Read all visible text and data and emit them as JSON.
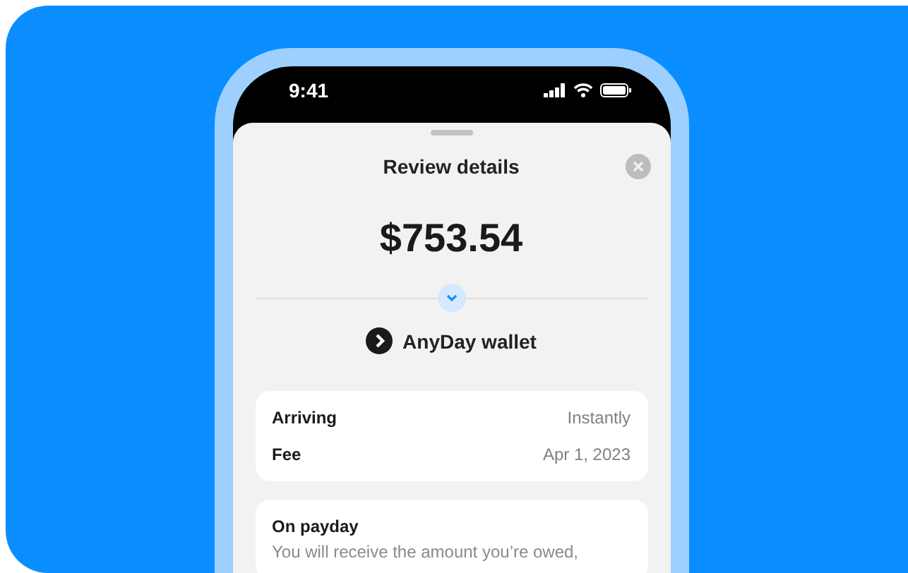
{
  "status_bar": {
    "time": "9:41"
  },
  "sheet": {
    "title": "Review details",
    "amount": "$753.54",
    "destination": "AnyDay wallet"
  },
  "details": [
    {
      "label": "Arriving",
      "value": "Instantly"
    },
    {
      "label": "Fee",
      "value": "Apr 1, 2023"
    }
  ],
  "note": {
    "title": "On payday",
    "text": "You will receive the amount you’re owed,"
  }
}
